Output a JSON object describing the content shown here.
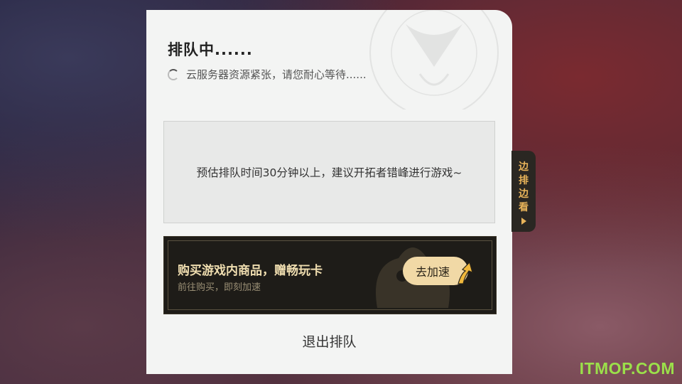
{
  "dialog": {
    "title": "排队中......",
    "status": "云服务器资源紧张，请您耐心等待......",
    "estimate": "预估排队时间30分钟以上，建议开拓者错峰进行游戏~",
    "promo": {
      "title": "购买游戏内商品，赠畅玩卡",
      "subtitle": "前往购买，即刻加速",
      "button_label": "去加速"
    },
    "exit_label": "退出排队"
  },
  "side_tab": {
    "chars": [
      "边",
      "排",
      "边",
      "看"
    ]
  },
  "watermark": "ITMOP.COM",
  "colors": {
    "accent_gold": "#e9b45a",
    "button_bg": "#f1d9a6",
    "watermark": "#9be04a"
  }
}
